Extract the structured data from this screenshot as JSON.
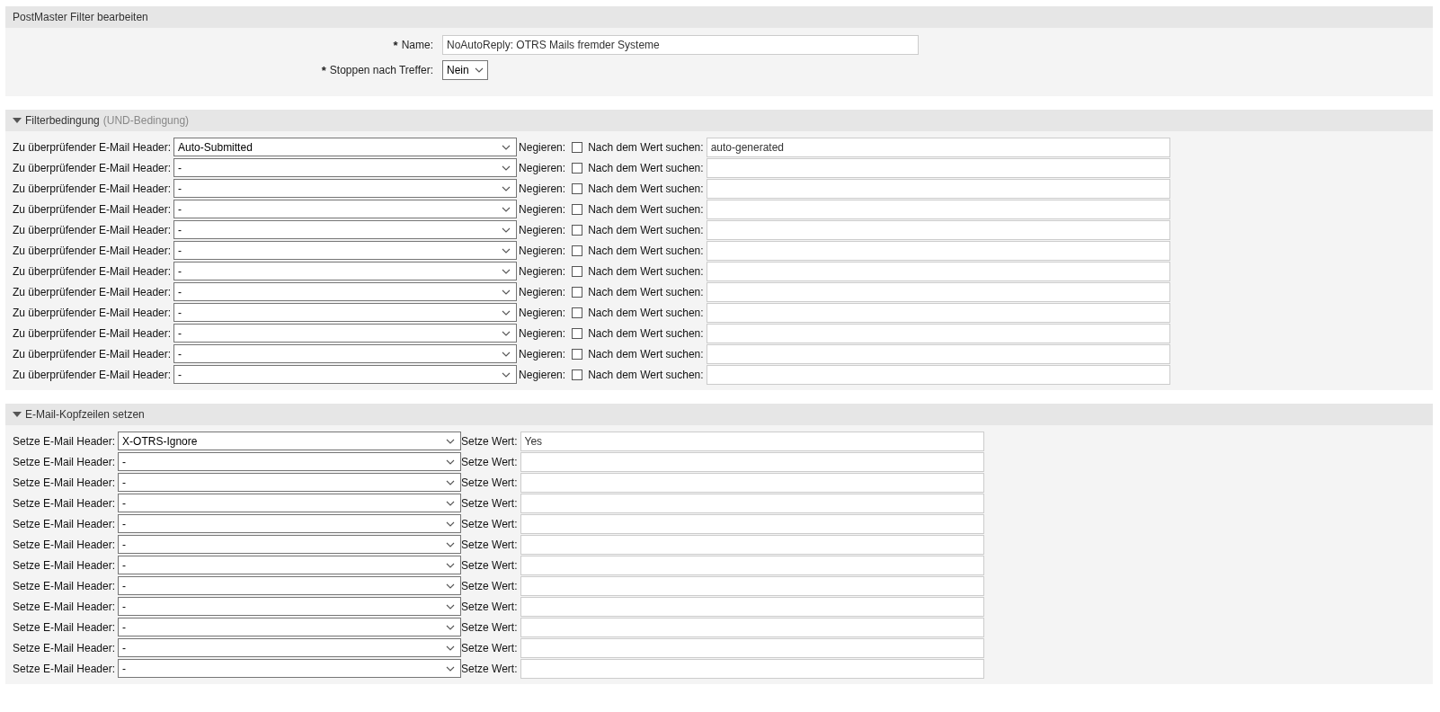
{
  "edit_panel": {
    "title": "PostMaster Filter bearbeiten",
    "fields": [
      {
        "label": "Name:",
        "required_mark": "*",
        "kind": "text",
        "value": "NoAutoReply: OTRS Mails fremder Systeme"
      },
      {
        "label": "Stoppen nach Treffer:",
        "required_mark": "*",
        "kind": "select",
        "value": "Nein"
      }
    ]
  },
  "filter_panel": {
    "title": "Filterbedingung",
    "hint": "(UND-Bedingung)",
    "expanded": true,
    "rows": [
      {
        "header_label": "Zu überprüfender E-Mail Header:",
        "header": "Auto-Submitted",
        "negate_label": "Negieren:",
        "negate": false,
        "value_label": "Nach dem Wert suchen:",
        "value": "auto-generated"
      },
      {
        "header_label": "Zu überprüfender E-Mail Header:",
        "header": "-",
        "negate_label": "Negieren:",
        "negate": false,
        "value_label": "Nach dem Wert suchen:",
        "value": ""
      },
      {
        "header_label": "Zu überprüfender E-Mail Header:",
        "header": "-",
        "negate_label": "Negieren:",
        "negate": false,
        "value_label": "Nach dem Wert suchen:",
        "value": ""
      },
      {
        "header_label": "Zu überprüfender E-Mail Header:",
        "header": "-",
        "negate_label": "Negieren:",
        "negate": false,
        "value_label": "Nach dem Wert suchen:",
        "value": ""
      },
      {
        "header_label": "Zu überprüfender E-Mail Header:",
        "header": "-",
        "negate_label": "Negieren:",
        "negate": false,
        "value_label": "Nach dem Wert suchen:",
        "value": ""
      },
      {
        "header_label": "Zu überprüfender E-Mail Header:",
        "header": "-",
        "negate_label": "Negieren:",
        "negate": false,
        "value_label": "Nach dem Wert suchen:",
        "value": ""
      },
      {
        "header_label": "Zu überprüfender E-Mail Header:",
        "header": "-",
        "negate_label": "Negieren:",
        "negate": false,
        "value_label": "Nach dem Wert suchen:",
        "value": ""
      },
      {
        "header_label": "Zu überprüfender E-Mail Header:",
        "header": "-",
        "negate_label": "Negieren:",
        "negate": false,
        "value_label": "Nach dem Wert suchen:",
        "value": ""
      },
      {
        "header_label": "Zu überprüfender E-Mail Header:",
        "header": "-",
        "negate_label": "Negieren:",
        "negate": false,
        "value_label": "Nach dem Wert suchen:",
        "value": ""
      },
      {
        "header_label": "Zu überprüfender E-Mail Header:",
        "header": "-",
        "negate_label": "Negieren:",
        "negate": false,
        "value_label": "Nach dem Wert suchen:",
        "value": ""
      },
      {
        "header_label": "Zu überprüfender E-Mail Header:",
        "header": "-",
        "negate_label": "Negieren:",
        "negate": false,
        "value_label": "Nach dem Wert suchen:",
        "value": ""
      },
      {
        "header_label": "Zu überprüfender E-Mail Header:",
        "header": "-",
        "negate_label": "Negieren:",
        "negate": false,
        "value_label": "Nach dem Wert suchen:",
        "value": ""
      }
    ]
  },
  "set_panel": {
    "title": "E-Mail-Kopfzeilen setzen",
    "expanded": true,
    "rows": [
      {
        "header_label": "Setze E-Mail Header:",
        "header": "X-OTRS-Ignore",
        "value_label": "Setze Wert:",
        "value": "Yes"
      },
      {
        "header_label": "Setze E-Mail Header:",
        "header": "-",
        "value_label": "Setze Wert:",
        "value": ""
      },
      {
        "header_label": "Setze E-Mail Header:",
        "header": "-",
        "value_label": "Setze Wert:",
        "value": ""
      },
      {
        "header_label": "Setze E-Mail Header:",
        "header": "-",
        "value_label": "Setze Wert:",
        "value": ""
      },
      {
        "header_label": "Setze E-Mail Header:",
        "header": "-",
        "value_label": "Setze Wert:",
        "value": ""
      },
      {
        "header_label": "Setze E-Mail Header:",
        "header": "-",
        "value_label": "Setze Wert:",
        "value": ""
      },
      {
        "header_label": "Setze E-Mail Header:",
        "header": "-",
        "value_label": "Setze Wert:",
        "value": ""
      },
      {
        "header_label": "Setze E-Mail Header:",
        "header": "-",
        "value_label": "Setze Wert:",
        "value": ""
      },
      {
        "header_label": "Setze E-Mail Header:",
        "header": "-",
        "value_label": "Setze Wert:",
        "value": ""
      },
      {
        "header_label": "Setze E-Mail Header:",
        "header": "-",
        "value_label": "Setze Wert:",
        "value": ""
      },
      {
        "header_label": "Setze E-Mail Header:",
        "header": "-",
        "value_label": "Setze Wert:",
        "value": ""
      },
      {
        "header_label": "Setze E-Mail Header:",
        "header": "-",
        "value_label": "Setze Wert:",
        "value": ""
      }
    ]
  }
}
